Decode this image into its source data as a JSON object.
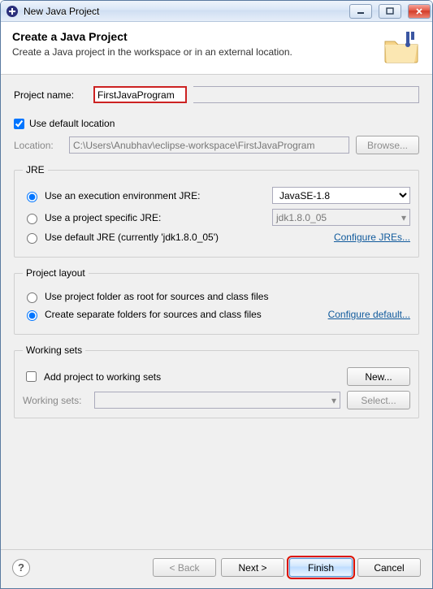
{
  "window": {
    "title": "New Java Project"
  },
  "banner": {
    "heading": "Create a Java Project",
    "desc": "Create a Java project in the workspace or in an external location."
  },
  "projectName": {
    "label": "Project name:",
    "value": "FirstJavaProgram"
  },
  "useDefaultLocation": {
    "label": "Use default location",
    "checked": true
  },
  "location": {
    "label": "Location:",
    "value": "C:\\Users\\Anubhav\\eclipse-workspace\\FirstJavaProgram",
    "browseLabel": "Browse..."
  },
  "jre": {
    "legend": "JRE",
    "opt1": {
      "label": "Use an execution environment JRE:",
      "selected": "JavaSE-1.8",
      "checked": true
    },
    "opt2": {
      "label": "Use a project specific JRE:",
      "selected": "jdk1.8.0_05",
      "checked": false
    },
    "opt3": {
      "label": "Use default JRE (currently 'jdk1.8.0_05')",
      "checked": false
    },
    "configureLink": "Configure JREs..."
  },
  "layout": {
    "legend": "Project layout",
    "opt1": {
      "label": "Use project folder as root for sources and class files",
      "checked": false
    },
    "opt2": {
      "label": "Create separate folders for sources and class files",
      "checked": true
    },
    "configureLink": "Configure default..."
  },
  "workingSets": {
    "legend": "Working sets",
    "addLabel": "Add project to working sets",
    "addChecked": false,
    "newLabel": "New...",
    "wsLabel": "Working sets:",
    "selectLabel": "Select..."
  },
  "footer": {
    "back": "< Back",
    "next": "Next >",
    "finish": "Finish",
    "cancel": "Cancel"
  }
}
